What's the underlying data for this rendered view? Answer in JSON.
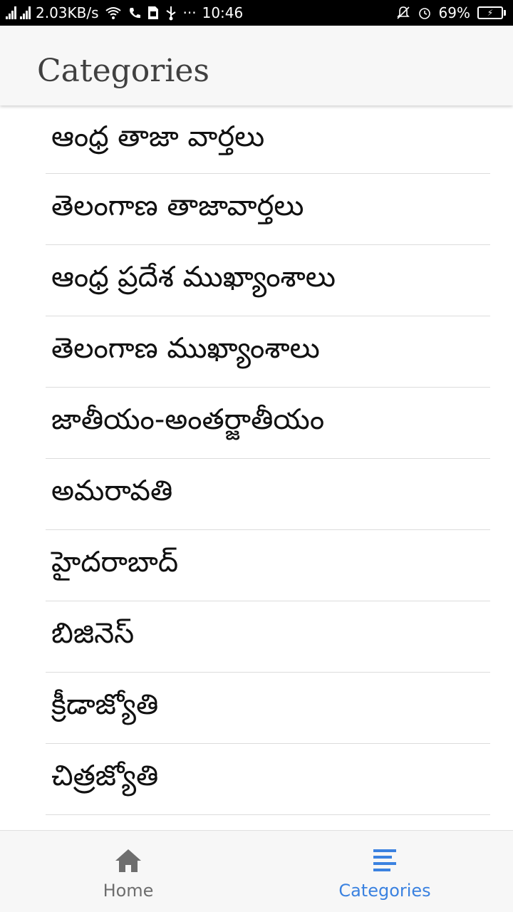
{
  "status_bar": {
    "speed": "2.03KB/s",
    "dots": "···",
    "time": "10:46",
    "battery_percent": "69%",
    "battery_level": 0.69,
    "icons": [
      "signal-icon",
      "signal-icon",
      "wifi-icon",
      "phone-icon",
      "sim-icon",
      "usb-icon",
      "mute-icon",
      "alarm-icon",
      "battery-icon"
    ]
  },
  "header": {
    "title": "Categories"
  },
  "categories": [
    {
      "label": "ఆంధ్ర తాజా వార్తలు"
    },
    {
      "label": "తెలంగాణ తాజావార్తలు"
    },
    {
      "label": "ఆంధ్ర ప్రదేశ ముఖ్యాంశాలు"
    },
    {
      "label": "తెలంగాణ ముఖ్యాంశాలు"
    },
    {
      "label": "జాతీయం-అంతర్జాతీయం"
    },
    {
      "label": "అమరావతి"
    },
    {
      "label": "హైదరాబాద్"
    },
    {
      "label": "బిజినెస్"
    },
    {
      "label": "క్రీడాజ్యోతి"
    },
    {
      "label": "చిత్రజ్యోతి"
    }
  ],
  "bottom_nav": {
    "home": {
      "label": "Home",
      "icon": "home-icon",
      "color": "#6e6e6e"
    },
    "categories": {
      "label": "Categories",
      "icon": "list-icon",
      "color": "#3b82e0",
      "active": true
    }
  }
}
